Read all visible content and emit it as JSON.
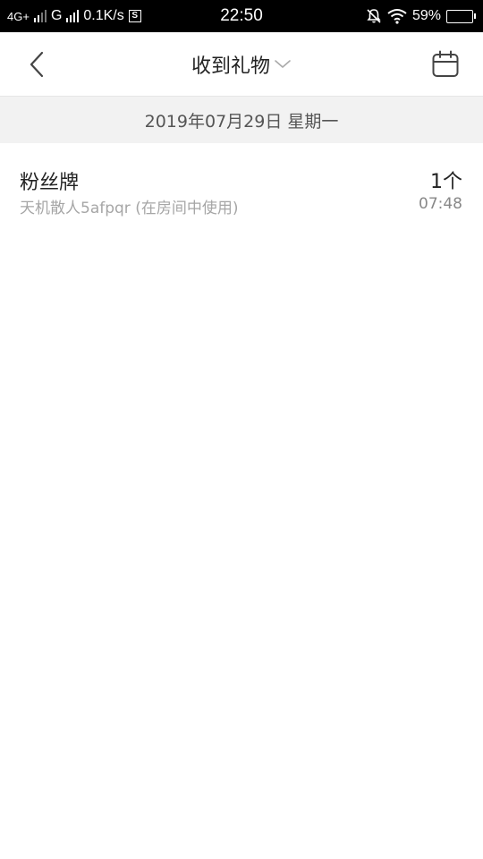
{
  "status_bar": {
    "network1": "4G+",
    "network2": "G",
    "speed": "0.1K/s",
    "s_badge": "S",
    "time": "22:50",
    "battery": "59%",
    "battery_level": 0.59
  },
  "nav": {
    "title": "收到礼物",
    "back_icon": "chevron-left-icon",
    "dropdown_icon": "chevron-down-icon",
    "calendar_icon": "calendar-icon"
  },
  "date_header": "2019年07月29日 星期一",
  "records": [
    {
      "name": "粉丝牌",
      "description": "天机散人5afpqr (在房间中使用)",
      "count": "1个",
      "time": "07:48"
    }
  ]
}
